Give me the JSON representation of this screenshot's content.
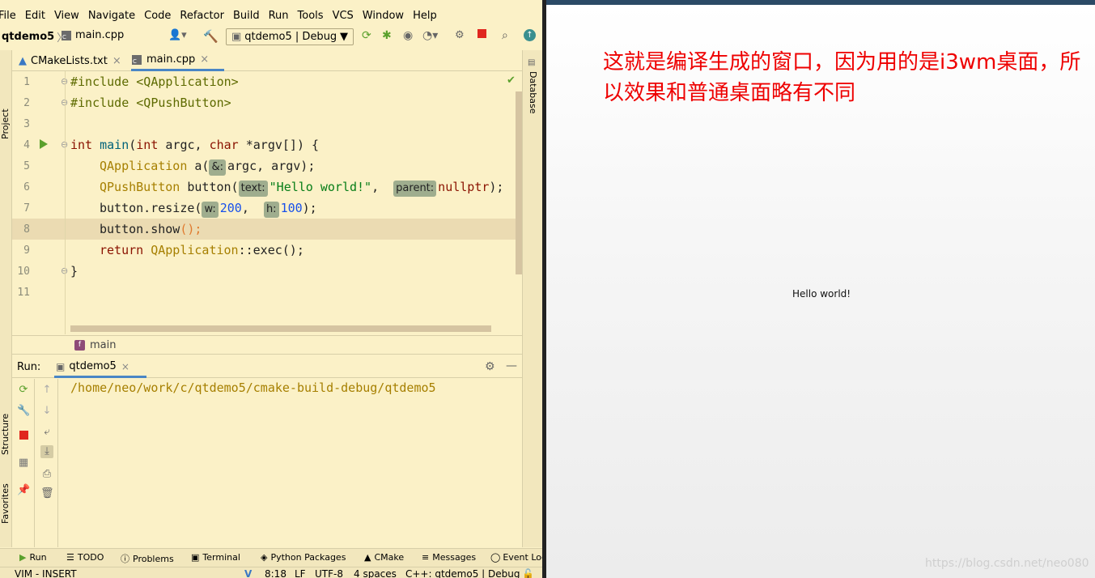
{
  "menu": [
    "File",
    "Edit",
    "View",
    "Navigate",
    "Code",
    "Refactor",
    "Build",
    "Run",
    "Tools",
    "VCS",
    "Window",
    "Help"
  ],
  "toolbar": {
    "project": "qtdemo5",
    "file": "main.cpp",
    "config": "qtdemo5 | Debug"
  },
  "left_tools": [
    "Project",
    "Structure",
    "Favorites"
  ],
  "right_tools": [
    "Database"
  ],
  "tabs": [
    {
      "label": "CMakeLists.txt",
      "active": false
    },
    {
      "label": "main.cpp",
      "active": true
    }
  ],
  "editor": {
    "line_numbers": [
      "1",
      "2",
      "3",
      "4",
      "5",
      "6",
      "7",
      "8",
      "9",
      "10",
      "11"
    ],
    "l1": "#include <QApplication>",
    "l2": "#include <QPushButton>",
    "l4_kw": "int",
    "l4_fn": "main",
    "l4_p1": "(",
    "l4_kw2": "int",
    "l4_p2": " argc, ",
    "l4_kw3": "char",
    "l4_p3": " *argv[]) {",
    "l5_ty": "QApplication",
    "l5_p1": " a(",
    "l5_hint": "&:",
    "l5_p2": "argc, argv);",
    "l6_ty": "QPushButton",
    "l6_p1": " button(",
    "l6_hint1": "text:",
    "l6_str": "\"Hello world!\"",
    "l6_p2": ", ",
    "l6_hint2": "parent:",
    "l6_kw": "nullptr",
    "l6_p3": ");",
    "l7_p1": "button.resize(",
    "l7_hint1": "w:",
    "l7_n1": "200",
    "l7_p2": ", ",
    "l7_hint2": "h:",
    "l7_n2": "100",
    "l7_p3": ");",
    "l8_p1": "button.show",
    "l8_p2": "();",
    "l9_kw": "return",
    "l9_ty": "QApplication",
    "l9_p1": "::exec();",
    "l10": "}"
  },
  "breadcrumb": "main",
  "run_panel": {
    "label": "Run:",
    "tab": "qtdemo5",
    "output": "/home/neo/work/c/qtdemo5/cmake-build-debug/qtdemo5"
  },
  "bottom_tabs": [
    "Run",
    "TODO",
    "Problems",
    "Terminal",
    "Python Packages",
    "CMake",
    "Messages",
    "Event Log"
  ],
  "status": {
    "mode": "VIM - INSERT",
    "position": "8:18",
    "line_sep": "LF",
    "encoding": "UTF-8",
    "indent": "4 spaces",
    "context": "C++: qtdemo5 | Debug"
  },
  "qt_window": {
    "annotation": "这就是编译生成的窗口，因为用的是i3wm桌面，所以效果和普通桌面略有不同",
    "button_text": "Hello world!",
    "watermark": "https://blog.csdn.net/neo080"
  },
  "colors": {
    "ide_bg": "#fbf1c7",
    "current_line": "#ebdbb2",
    "annotation_red": "#ee0000",
    "stop_red": "#e0271f",
    "run_green": "#5aa02c"
  }
}
